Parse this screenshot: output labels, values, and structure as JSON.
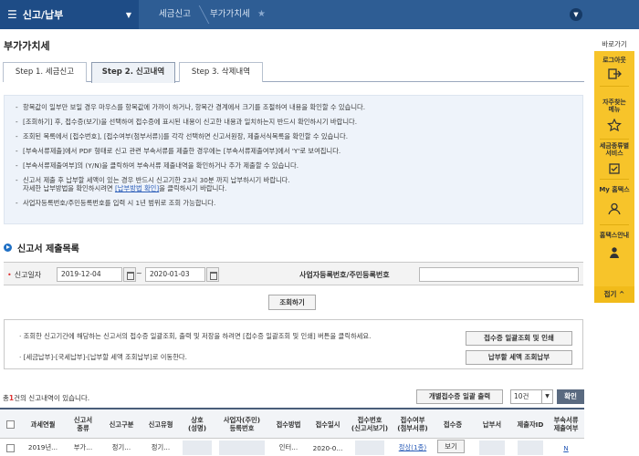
{
  "topbar": {
    "menu_label": "신고/납부",
    "breadcrumb_1": "세금신고",
    "breadcrumb_2": "부가가치세"
  },
  "page_title": "부가가치세",
  "tabs": [
    {
      "label": "Step 1. 세금신고"
    },
    {
      "label": "Step 2. 신고내역"
    },
    {
      "label": "Step 3. 삭제내역"
    }
  ],
  "info": {
    "l1": "항목값이 일부만 보일 경우 마우스를 항목값에 가까이 하거나, 항목간 경계에서 크기를 조절하여 내용을 확인할 수 있습니다.",
    "l2": "[조회하기] 후, 접수증(보기)을 선택하여 접수증에 표시된 내용이 신고한 내용과 일치하는지 반드시 확인하시기 바랍니다.",
    "l3": "조회된 목록에서 [접수번호], [접수여부(첨부서류)]를 각각 선택하면 신고서원장, 제출서식목록을 확인할 수 있습니다.",
    "l4": "[부속서류제출]에서 PDF 형태로 신고 관련 부속서류를 제출한 경우에는 [부속서류제출여부]에서 'Y'로 보여집니다.",
    "l5": "[부속서류제출여부]의 (Y/N)을 클릭하여 부속서류 제출내역을 확인하거나 추가 제출할 수 있습니다.",
    "l6a": "신고서 제출 후 납부할 세액이 있는 경우 반드시 신고기한 23시 30분 까지 납부하시기 바랍니다.",
    "l6b_pre": "자세한 납부방법을 확인하시려면 ",
    "l6b_link": "[납부방법 확인]",
    "l6b_post": "을 클릭하시기 바랍니다.",
    "l7": "사업자등록번호/주민등록번호를 입력 시 1년 범위로 조회 가능합니다."
  },
  "section_title": "신고서 제출목록",
  "search": {
    "date_label": "신고일자",
    "date_from": "2019-12-04",
    "date_to": "2020-01-03",
    "biz_label": "사업자등록번호/주민등록번호",
    "biz_value": "",
    "search_button": "조회하기"
  },
  "notice": {
    "n1": "· 조회한 신고기간에 해당하는 신고서의 접수증 일괄조회, 출력 및 저장을 하려면 [접수증 일괄조회 및 인쇄] 버튼을 클릭하세요.",
    "n2": "· [세금납부]-[국세납부]-[납부할 세액 조회납부]로 이동한다.",
    "receipt_button": "접수증 일괄조회 및 인쇄",
    "tax_button": "납부할 세액 조회납부"
  },
  "results": {
    "count_pre": "총",
    "count": "1",
    "count_post": "건의 신고내역이 있습니다.",
    "batch_button": "개별접수증 일괄 출력",
    "page_size": "10건",
    "ok_button": "확인"
  },
  "table": {
    "headers": [
      "과세연월",
      "신고서\n종류",
      "신고구분",
      "신고유형",
      "상호\n(성명)",
      "사업자(주민)\n등록번호",
      "접수방법",
      "접수일시",
      "접수번호\n(신고서보기)",
      "접수여부\n(첨부서류)",
      "접수증",
      "납부서",
      "제출자ID",
      "부속서류\n제출여부"
    ],
    "row": {
      "period": "2019년...",
      "kind": "부가...",
      "category": "정기...",
      "type": "정기...",
      "method": "인터...",
      "date": "2020-0...",
      "status": "정상(1종)",
      "receipt": "보기",
      "attach": "N"
    }
  },
  "quick": {
    "title": "바로가기",
    "items": [
      "로그아웃",
      "자주찾는\n메뉴",
      "세금종류별\n서비스",
      "My 홈택스",
      "홈택스안내"
    ],
    "fold": "접기 ^"
  },
  "colors": {
    "topbar": "#2e5d94",
    "menu": "#1e4c86",
    "quick_panel": "#f7c42a",
    "info_bg": "#eef3fa",
    "link": "#2a5cb8"
  }
}
